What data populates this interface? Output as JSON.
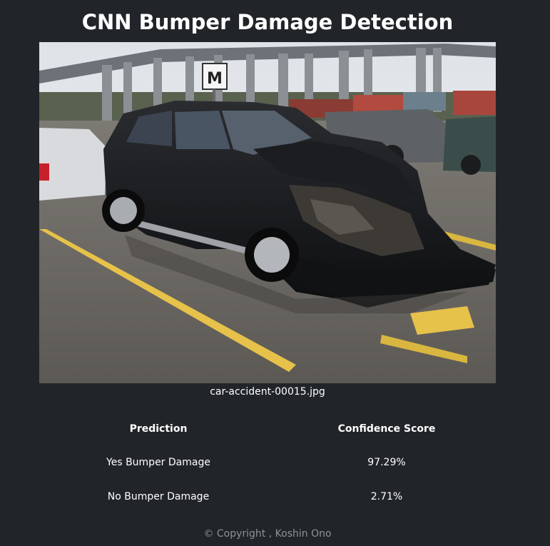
{
  "page": {
    "title": "CNN Bumper Damage Detection"
  },
  "image": {
    "description_icon": "car-photo",
    "sign_letter": "M",
    "filename": "car-accident-00015.jpg"
  },
  "results": {
    "headers": [
      "Prediction",
      "Confidence Score"
    ],
    "rows": [
      {
        "prediction": "Yes Bumper Damage",
        "confidence": "97.29%"
      },
      {
        "prediction": "No Bumper Damage",
        "confidence": "2.71%"
      }
    ]
  },
  "footer": {
    "text": "© Copyright , Koshin Ono"
  },
  "colors": {
    "background": "#212529",
    "text": "#ffffff",
    "footer_text": "#8e9297",
    "parking_line": "#e6c24a"
  }
}
